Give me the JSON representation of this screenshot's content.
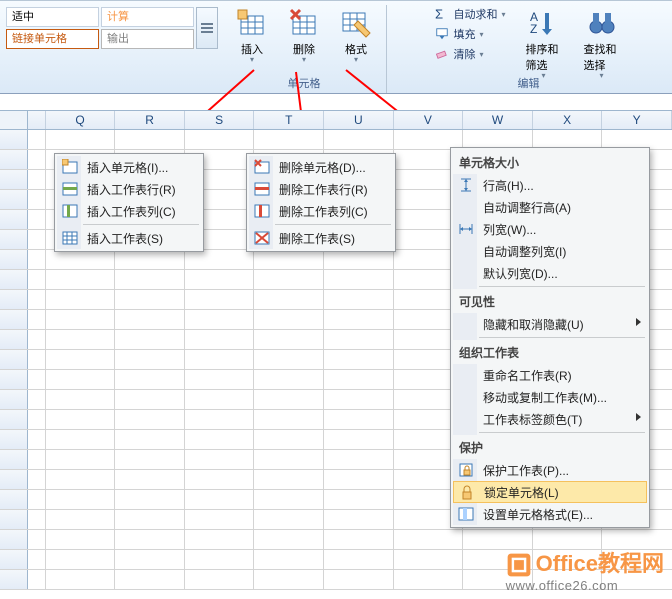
{
  "ribbon": {
    "styles": {
      "moderate": "适中",
      "calculation": "计算",
      "hyperlink": "链接单元格",
      "output": "输出"
    },
    "cells": {
      "insert": "插入",
      "delete": "删除",
      "format": "格式",
      "caption": "单元格"
    },
    "editing": {
      "autosum_label": "自动求和",
      "fill_label": "填充",
      "clear_label": "清除",
      "sort_filter": "排序和筛选",
      "find_select": "查找和选择",
      "caption": "编辑"
    }
  },
  "columns": [
    "Q",
    "R",
    "S",
    "T",
    "U",
    "V",
    "W",
    "X",
    "Y"
  ],
  "menus": {
    "insert": {
      "items": [
        "插入单元格(I)...",
        "插入工作表行(R)",
        "插入工作表列(C)",
        "插入工作表(S)"
      ]
    },
    "delete": {
      "items": [
        "删除单元格(D)...",
        "删除工作表行(R)",
        "删除工作表列(C)",
        "删除工作表(S)"
      ]
    },
    "format": {
      "cell_size_header": "单元格大小",
      "row_height": "行高(H)...",
      "autofit_row": "自动调整行高(A)",
      "col_width": "列宽(W)...",
      "autofit_col": "自动调整列宽(I)",
      "default_width": "默认列宽(D)...",
      "visibility_header": "可见性",
      "hide_unhide": "隐藏和取消隐藏(U)",
      "organize_header": "组织工作表",
      "rename": "重命名工作表(R)",
      "move_copy": "移动或复制工作表(M)...",
      "tab_color": "工作表标签颜色(T)",
      "protect_header": "保护",
      "protect_sheet": "保护工作表(P)...",
      "lock_cell": "锁定单元格(L)",
      "cell_format": "设置单元格格式(E)..."
    }
  },
  "watermark": {
    "brand_cn": "Office教程网",
    "url": "www.office26.com"
  }
}
